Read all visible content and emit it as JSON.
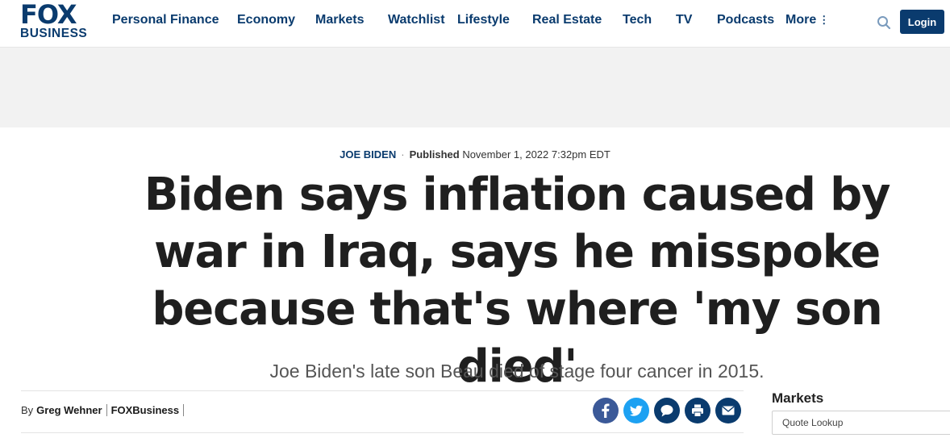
{
  "brand": {
    "logo_top": "FOX",
    "logo_bottom": "BUSINESS"
  },
  "nav": {
    "items": [
      "Personal Finance",
      "Economy",
      "Markets",
      "Watchlist",
      "Lifestyle",
      "Real Estate",
      "Tech",
      "TV",
      "Podcasts"
    ],
    "more_label": "More",
    "login_label": "Login"
  },
  "article": {
    "category": "JOE BIDEN",
    "published_label": "Published",
    "published_date": "November 1, 2022 7:32pm EDT",
    "headline": "Biden says inflation caused by war in Iraq, says he misspoke because that's where 'my son died'",
    "subhead": "Joe Biden's late son Beau died of stage four cancer in 2015.",
    "by_label": "By",
    "author": "Greg Wehner",
    "outlet": "FOXBusiness"
  },
  "share": [
    {
      "name": "facebook-share",
      "color": "#3b5998",
      "icon": "facebook-icon"
    },
    {
      "name": "twitter-share",
      "color": "#1da1f2",
      "icon": "twitter-icon"
    },
    {
      "name": "comments",
      "color": "#0a3b6e",
      "icon": "comment-icon"
    },
    {
      "name": "print",
      "color": "#0a3b6e",
      "icon": "print-icon"
    },
    {
      "name": "email",
      "color": "#0a3b6e",
      "icon": "email-icon"
    }
  ],
  "sidebar": {
    "markets_title": "Markets",
    "quote_placeholder": "Quote Lookup"
  },
  "colors": {
    "brand": "#0a3b6e",
    "ad_band": "#f2f2f2"
  }
}
